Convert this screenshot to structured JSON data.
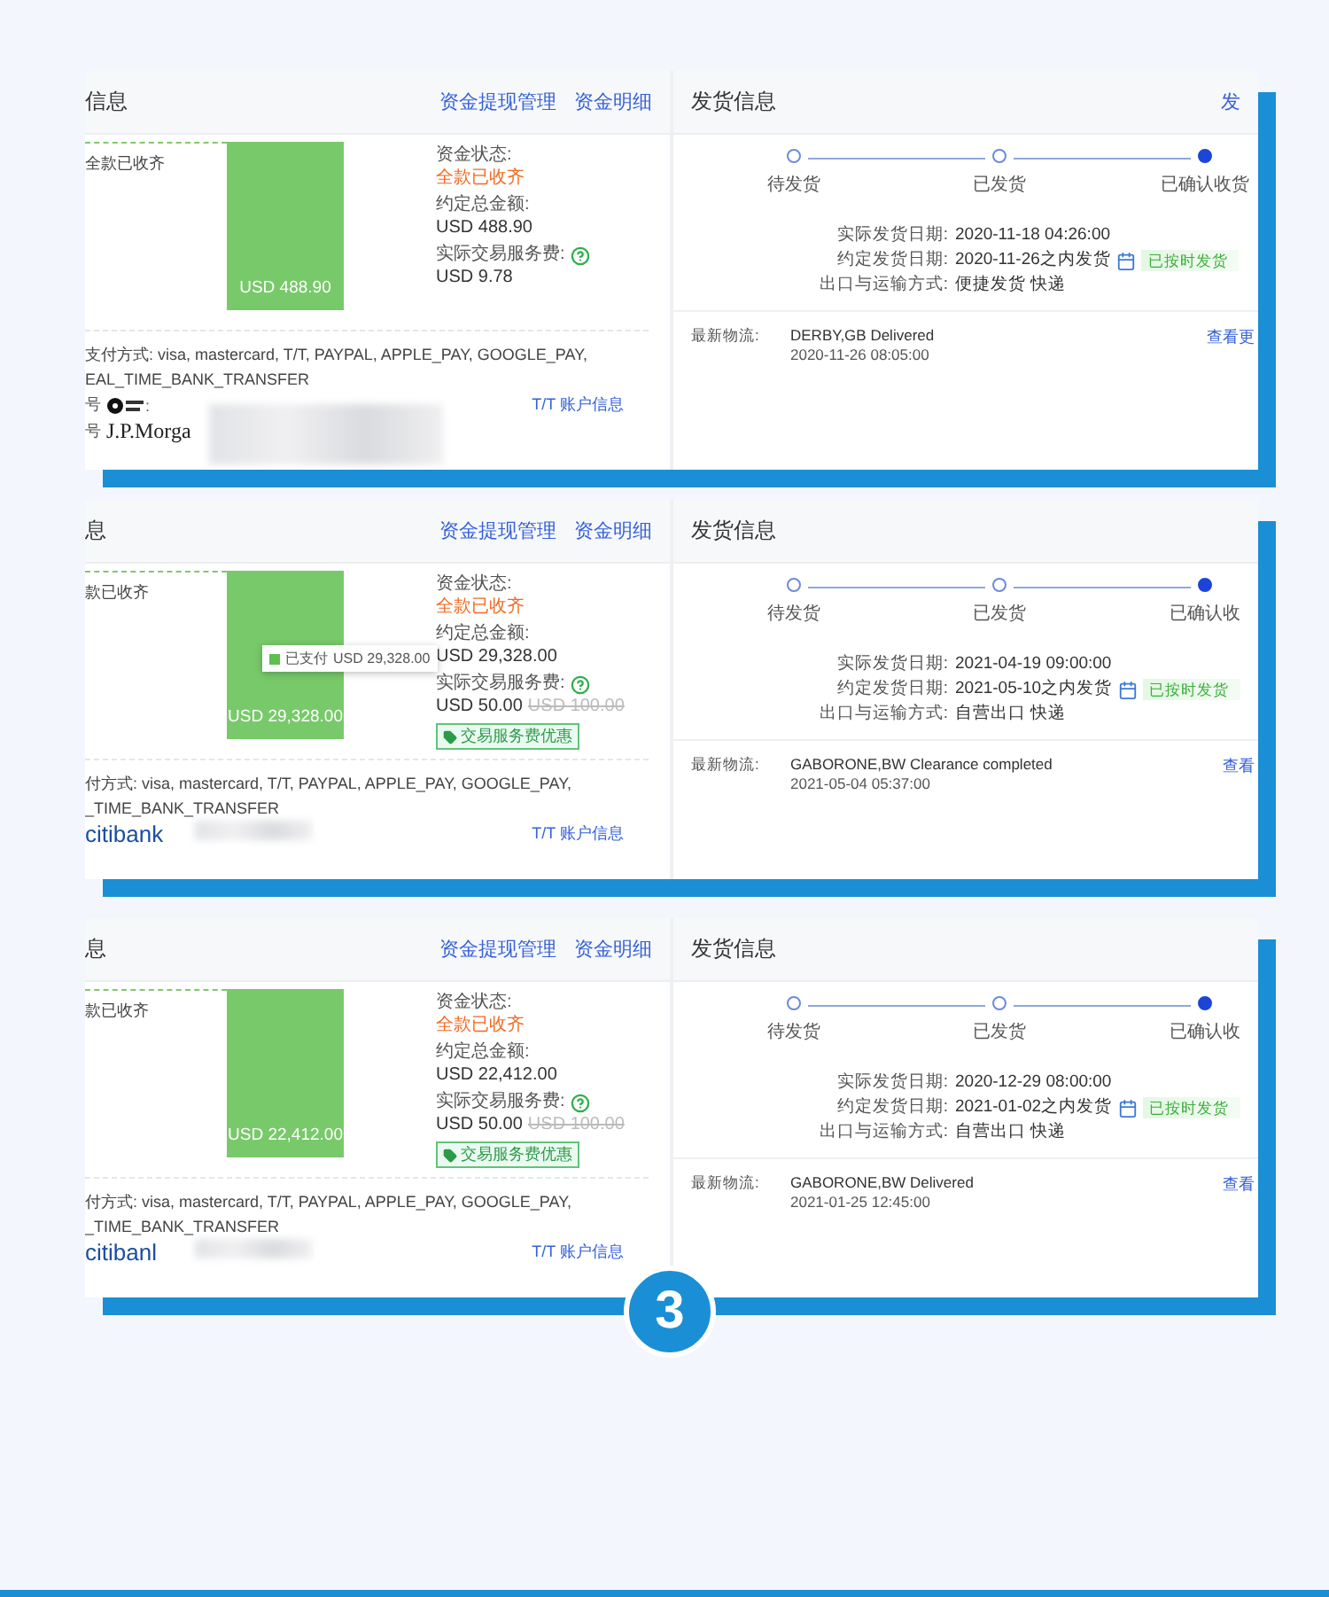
{
  "panels": [
    {
      "funds": {
        "title": "信息",
        "links": [
          "资金提现管理",
          "资金明细"
        ],
        "collected_note": "全款已收齐",
        "bar_label": "USD 488.90",
        "status_label": "资金状态:",
        "status_value": "全款已收齐",
        "total_label": "约定总金额:",
        "total_value": "USD 488.90",
        "fee_label": "实际交易服务费:",
        "fee_value": "USD 9.78",
        "payment_lines": [
          "支付方式: visa, mastercard, T/T, PAYPAL, APPLE_PAY, GOOGLE_PAY,",
          "EAL_TIME_BANK_TRANSFER"
        ],
        "accounts": [
          {
            "kind": "emblem",
            "prefix": "号",
            "suffix": ":"
          },
          {
            "kind": "serif",
            "prefix": "号",
            "logo": "J.P.Morga"
          }
        ],
        "account_link": "T/T 账户信息"
      },
      "shipping": {
        "title": "发货信息",
        "header_link": "发",
        "steps": [
          {
            "label": "待发货",
            "current": false
          },
          {
            "label": "已发货",
            "current": false
          },
          {
            "label": "已确认收货",
            "current": true
          }
        ],
        "details": [
          {
            "label": "实际发货日期:",
            "value": "2020-11-18 04:26:00"
          },
          {
            "label": "约定发货日期:",
            "value": "2020-11-26之内发货",
            "badge": "已按时发货"
          },
          {
            "label": "出口与运输方式:",
            "value": "便捷发货 快递"
          }
        ],
        "logistics": {
          "label": "最新物流:",
          "event": "DERBY,GB  Delivered",
          "time": "2020-11-26 08:05:00",
          "link": "查看更"
        }
      }
    },
    {
      "funds": {
        "title": "息",
        "links": [
          "资金提现管理",
          "资金明细"
        ],
        "collected_note": "款已收齐",
        "bar_label": "USD 29,328.00",
        "tooltip": {
          "label": "已支付",
          "amount": "USD 29,328.00"
        },
        "status_label": "资金状态:",
        "status_value": "全款已收齐",
        "total_label": "约定总金额:",
        "total_value": "USD 29,328.00",
        "fee_label": "实际交易服务费:",
        "fee_value": "USD 50.00",
        "fee_original": "USD 100.00",
        "discount_tag": "交易服务费优惠",
        "payment_lines": [
          "付方式: visa, mastercard, T/T, PAYPAL, APPLE_PAY, GOOGLE_PAY,",
          "_TIME_BANK_TRANSFER"
        ],
        "accounts": [
          {
            "kind": "citi",
            "logo": "citibank"
          }
        ],
        "account_link": "T/T 账户信息"
      },
      "shipping": {
        "title": "发货信息",
        "steps": [
          {
            "label": "待发货",
            "current": false
          },
          {
            "label": "已发货",
            "current": false
          },
          {
            "label": "已确认收",
            "current": true
          }
        ],
        "details": [
          {
            "label": "实际发货日期:",
            "value": "2021-04-19 09:00:00"
          },
          {
            "label": "约定发货日期:",
            "value": "2021-05-10之内发货",
            "badge": "已按时发货"
          },
          {
            "label": "出口与运输方式:",
            "value": "自营出口 快递"
          }
        ],
        "logistics": {
          "label": "最新物流:",
          "event": "GABORONE,BW  Clearance completed",
          "time": "2021-05-04 05:37:00",
          "link": "查看"
        }
      }
    },
    {
      "funds": {
        "title": "息",
        "links": [
          "资金提现管理",
          "资金明细"
        ],
        "collected_note": "款已收齐",
        "bar_label": "USD 22,412.00",
        "status_label": "资金状态:",
        "status_value": "全款已收齐",
        "total_label": "约定总金额:",
        "total_value": "USD 22,412.00",
        "fee_label": "实际交易服务费:",
        "fee_value": "USD 50.00",
        "fee_original": "USD 100.00",
        "discount_tag": "交易服务费优惠",
        "payment_lines": [
          "付方式: visa, mastercard, T/T, PAYPAL, APPLE_PAY, GOOGLE_PAY,",
          "_TIME_BANK_TRANSFER"
        ],
        "accounts": [
          {
            "kind": "citi",
            "logo": "citibanl"
          }
        ],
        "account_link": "T/T 账户信息"
      },
      "shipping": {
        "title": "发货信息",
        "steps": [
          {
            "label": "待发货",
            "current": false
          },
          {
            "label": "已发货",
            "current": false
          },
          {
            "label": "已确认收",
            "current": true
          }
        ],
        "details": [
          {
            "label": "实际发货日期:",
            "value": "2020-12-29 08:00:00"
          },
          {
            "label": "约定发货日期:",
            "value": "2021-01-02之内发货",
            "badge": "已按时发货"
          },
          {
            "label": "出口与运输方式:",
            "value": "自营出口 快递"
          }
        ],
        "logistics": {
          "label": "最新物流:",
          "event": "GABORONE,BW  Delivered",
          "time": "2021-01-25 12:45:00",
          "link": "查看"
        }
      }
    }
  ],
  "page_number": "3"
}
